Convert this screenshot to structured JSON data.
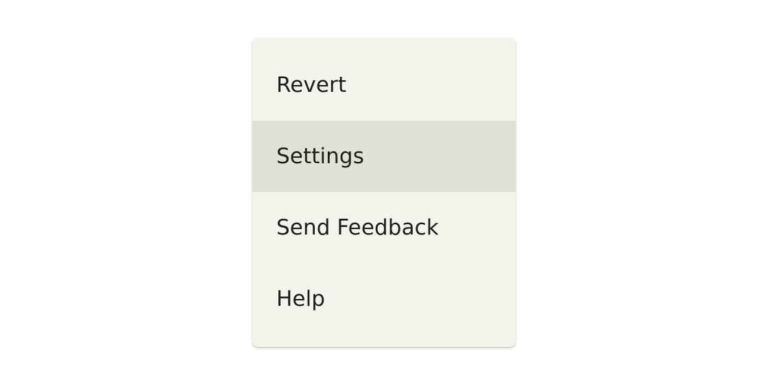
{
  "menu": {
    "items": [
      {
        "label": "Revert",
        "highlighted": false
      },
      {
        "label": "Settings",
        "highlighted": true
      },
      {
        "label": "Send Feedback",
        "highlighted": false
      },
      {
        "label": "Help",
        "highlighted": false
      }
    ]
  },
  "colors": {
    "menu_background": "#f2f5eb",
    "highlight_background": "#dfe3d5",
    "text": "#1c1f19"
  }
}
